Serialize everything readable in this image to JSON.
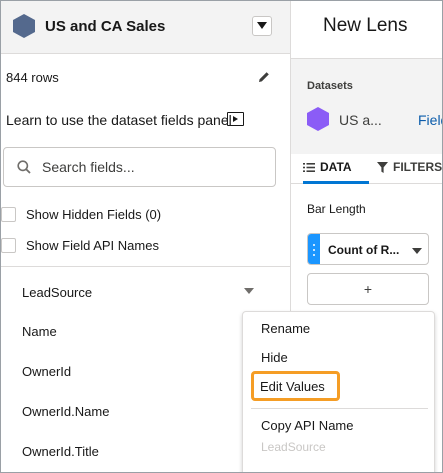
{
  "left": {
    "dataset_title": "US and CA Sales",
    "rows_text": "844 rows",
    "learn_text": "Learn to use the dataset fields panel",
    "search": {
      "placeholder": "Search fields..."
    },
    "checkboxes": [
      {
        "label": "Show Hidden Fields (0)",
        "checked": false
      },
      {
        "label": "Show Field API Names",
        "checked": false
      }
    ],
    "fields": [
      "LeadSource",
      "Name",
      "OwnerId",
      "OwnerId.Name",
      "OwnerId.Title"
    ]
  },
  "right": {
    "lens_title": "New Lens",
    "datasets_label": "Datasets",
    "dataset_short": "US a...",
    "fields_link": "Fields",
    "tabs": [
      {
        "label": "DATA",
        "active": true
      },
      {
        "label": "FILTERS",
        "active": false
      }
    ],
    "bar_length_label": "Bar Length",
    "measure_label": "Count of R...",
    "add_label": "+"
  },
  "menu": {
    "items": [
      "Rename",
      "Hide",
      "Edit Values",
      "Copy API Name"
    ],
    "sub_label": "LeadSource",
    "highlighted": "Edit Values"
  },
  "colors": {
    "dataset_icon": "#54698d",
    "dataset_icon_right": "#8b5cf6",
    "accent": "#0176d3",
    "highlight_border": "#f59d25"
  }
}
